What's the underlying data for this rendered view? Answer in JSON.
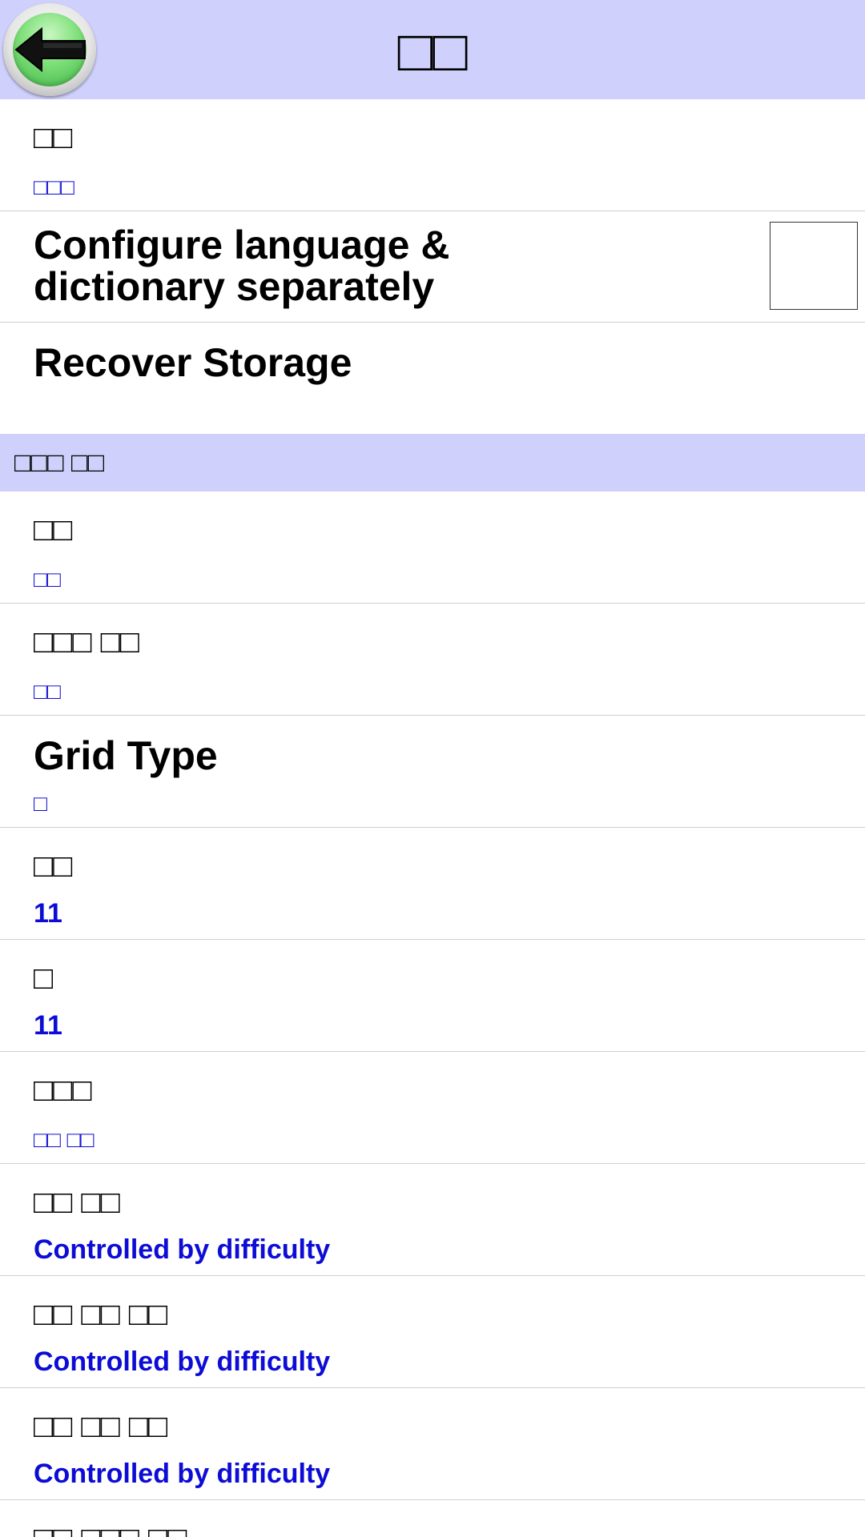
{
  "header": {
    "title": "□□"
  },
  "prefs": [
    {
      "title": "□□",
      "summary": "□□□",
      "glyph": true
    }
  ],
  "toggle": {
    "title": "Configure language & dictionary separately",
    "checked": false
  },
  "recover": {
    "title": "Recover Storage"
  },
  "category": {
    "label": "□□□ □□"
  },
  "game_prefs": [
    {
      "title": "□□",
      "summary": "□□",
      "title_glyph": true,
      "summary_glyph": true
    },
    {
      "title": "□□□ □□",
      "summary": "□□",
      "title_glyph": true,
      "summary_glyph": true
    },
    {
      "title": "Grid Type",
      "summary": "□",
      "title_glyph": false,
      "summary_glyph": true
    },
    {
      "title": "□□",
      "summary": "11",
      "title_glyph": true,
      "summary_glyph": false
    },
    {
      "title": "□",
      "summary": "11",
      "title_glyph": true,
      "summary_glyph": false
    },
    {
      "title": "□□□",
      "summary": "□□ □□",
      "title_glyph": true,
      "summary_glyph": true
    },
    {
      "title": "□□ □□",
      "summary": "Controlled by difficulty",
      "title_glyph": true,
      "summary_glyph": false
    },
    {
      "title": "□□ □□ □□",
      "summary": "Controlled by difficulty",
      "title_glyph": true,
      "summary_glyph": false
    },
    {
      "title": "□□ □□ □□",
      "summary": "Controlled by difficulty",
      "title_glyph": true,
      "summary_glyph": false
    }
  ],
  "partial_row": {
    "title": "□□ □□□ □□"
  },
  "colors": {
    "header_bg": "#cfd0fc",
    "summary_text": "#0c0cd6",
    "divider": "#cfcfcf"
  },
  "icons": {
    "back": "back-arrow-icon"
  }
}
